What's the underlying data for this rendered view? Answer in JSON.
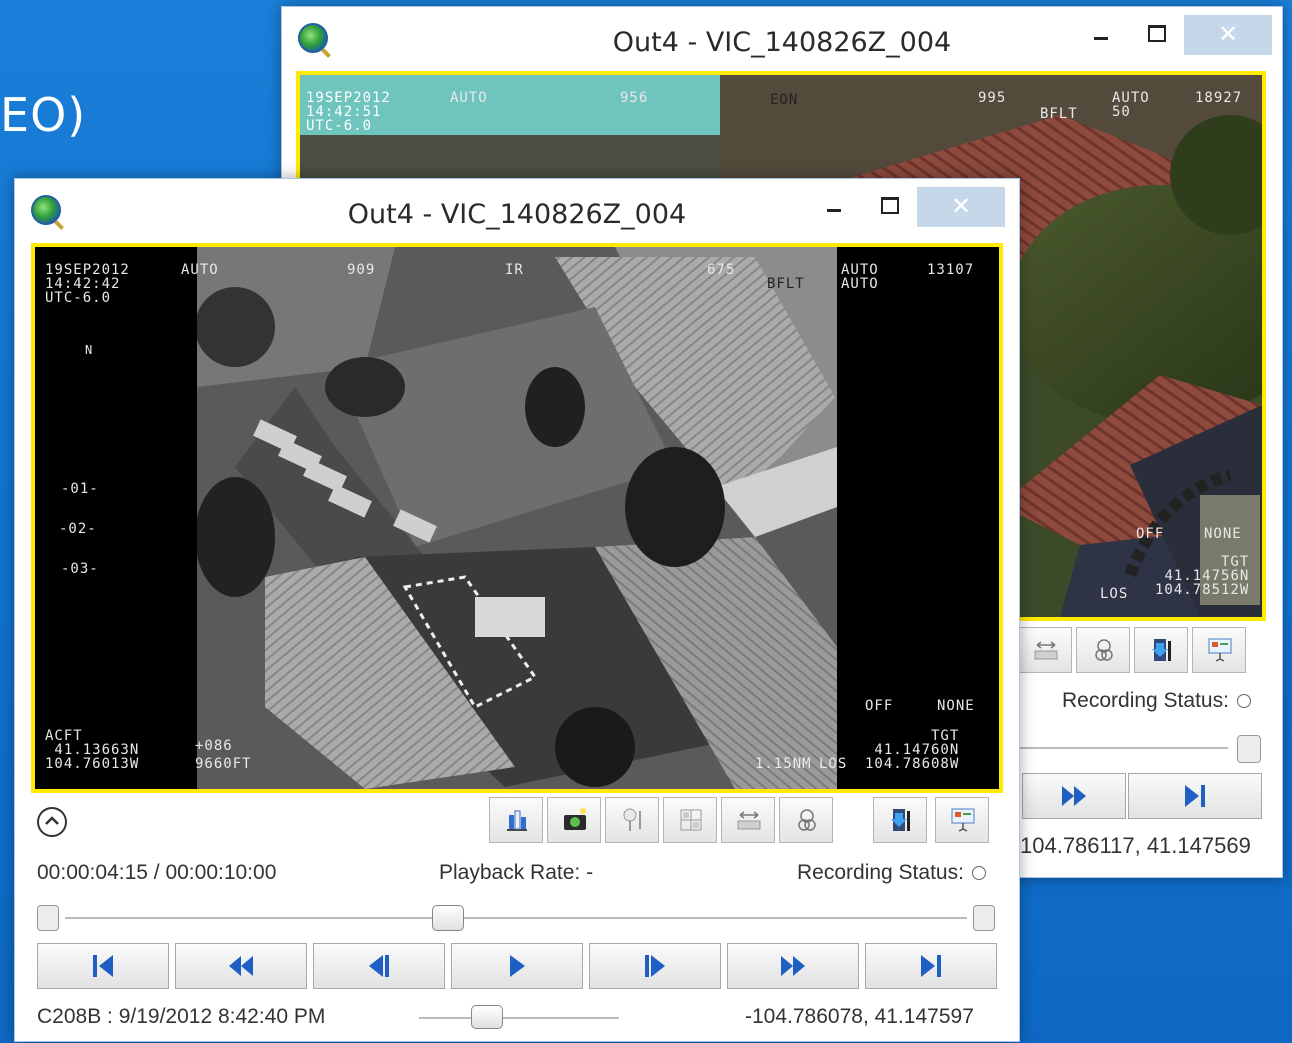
{
  "background": {
    "title_fragment": "EO)"
  },
  "back_window": {
    "title": "Out4 - VIC_140826Z_004",
    "close_label": "✕",
    "hud": {
      "tl": "19SEP2012\n14:42:51\nUTC-6.0",
      "auto_top": "AUTO",
      "n956": "956",
      "eon": "EON",
      "n995": "995",
      "bflt": "BFLT",
      "auto_r": "AUTO\n50",
      "alt": "18927",
      "off": "OFF",
      "none": "NONE",
      "tgt": "TGT\n41.14756N\n104.78512W",
      "los": "LOS"
    },
    "recording_status_label": "Recording Status:",
    "coords": "104.786117, 41.147569"
  },
  "front_window": {
    "title": "Out4 - VIC_140826Z_004",
    "close_label": "✕",
    "hud": {
      "datetime": "19SEP2012\n14:42:42\nUTC-6.0",
      "auto_top": "AUTO",
      "n909": "909",
      "ir": "IR",
      "n675": "675",
      "bflt": "BFLT",
      "auto2": "AUTO\nAUTO",
      "alt": "13107",
      "north": "N",
      "scale1": "-01-",
      "scale2": "-02-",
      "scale3": "-03-",
      "off": "OFF",
      "none": "NONE",
      "acft": "ACFT\n 41.13663N\n104.76013W",
      "mid1": "+086",
      "mid2": "9660FT",
      "tgt": "TGT\n 41.14760N\n104.78608W",
      "los": "LOS",
      "rng": "1.15NM"
    },
    "time_display": "00:00:04:15 / 00:00:10:00",
    "playback_rate": "Playback Rate: -",
    "recording_status": "Recording Status:",
    "footer_left": "C208B : 9/19/2012 8:42:40 PM",
    "footer_right": "-104.786078, 41.147597",
    "progress_fraction": 0.425,
    "toolbar": [
      "chart-icon",
      "camera-icon",
      "marker-icon",
      "grid-icon",
      "ruler-icon",
      "link-icon",
      "download-icon",
      "presentation-icon"
    ]
  },
  "colors": {
    "desktop": "#1273cf",
    "video_border": "#ffea00",
    "icon_blue": "#1f5fc4"
  }
}
